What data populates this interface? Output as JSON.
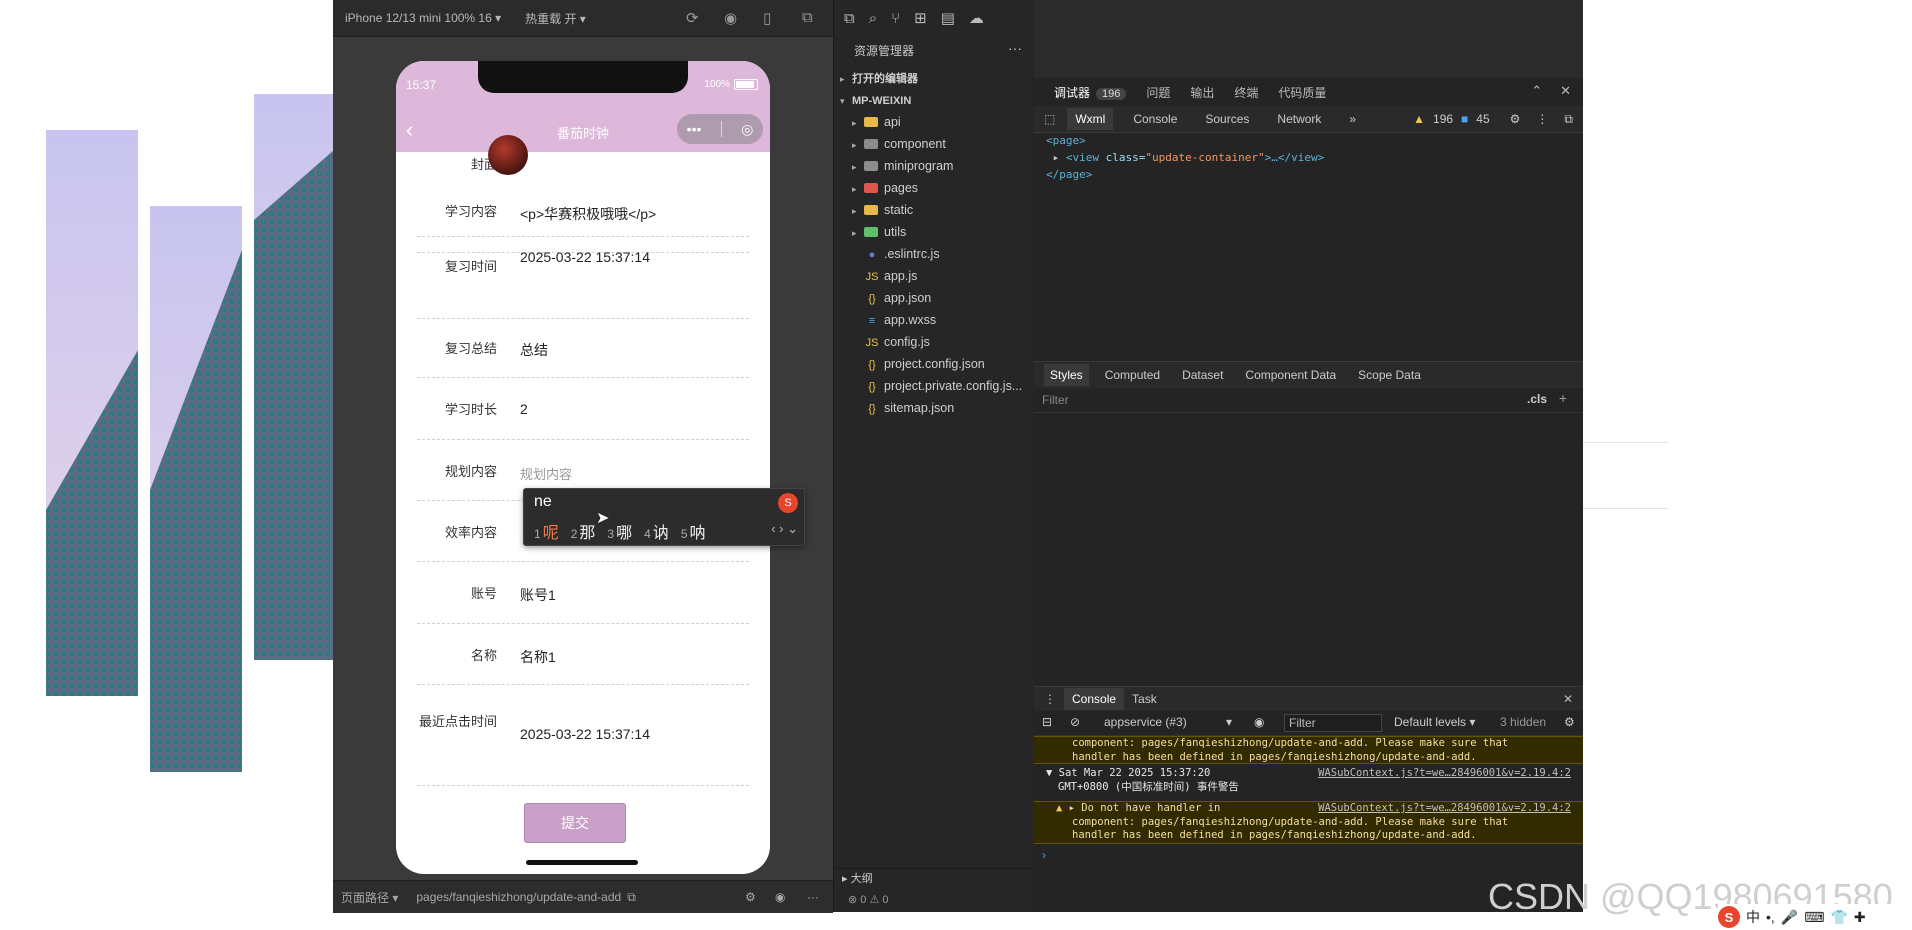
{
  "simulator": {
    "device": "iPhone 12/13 mini 100% 16 ▾",
    "hot_reload": "热重载 开 ▾",
    "phone": {
      "status_time": "15:37",
      "battery_text": "100%",
      "nav_title": "番茄时钟",
      "form": {
        "cover_label": "封面",
        "study_label": "学习内容",
        "study_value": "<p>华赛积极哦哦</p>",
        "review_time_label": "复习时间",
        "review_time_value": "2025-03-22 15:37:14",
        "review_summary_label": "复习总结",
        "review_summary_value": "总结",
        "duration_label": "学习时长",
        "duration_value": "2",
        "plan_label": "规划内容",
        "plan_placeholder": "规划内容",
        "efficiency_label": "效率内容",
        "account_label": "账号",
        "account_value": "账号1",
        "name_label": "名称",
        "name_value": "名称1",
        "last_click_label": "最近点击时间",
        "last_click_value": "2025-03-22 15:37:14",
        "submit_label": "提交"
      }
    },
    "bottom": {
      "path_label": "页面路径 ▾",
      "path_value": "pages/fanqieshizhong/update-and-add"
    }
  },
  "ime": {
    "input": "ne",
    "candidates": [
      {
        "num": "1",
        "text": "呢"
      },
      {
        "num": "2",
        "text": "那"
      },
      {
        "num": "3",
        "text": "哪"
      },
      {
        "num": "4",
        "text": "讷"
      },
      {
        "num": "5",
        "text": "呐"
      }
    ],
    "arrows": "‹ › ⌄"
  },
  "explorer": {
    "title": "资源管理器",
    "more": "···",
    "open_editors": "打开的编辑器",
    "root": "MP-WEIXIN",
    "items": [
      {
        "name": "api",
        "type": "folder",
        "color": "#e9b84a"
      },
      {
        "name": "component",
        "type": "folder",
        "color": "#8c8c8c"
      },
      {
        "name": "miniprogram",
        "type": "folder",
        "color": "#8c8c8c"
      },
      {
        "name": "pages",
        "type": "folder",
        "color": "#e0574f"
      },
      {
        "name": "static",
        "type": "folder",
        "color": "#e9b84a"
      },
      {
        "name": "utils",
        "type": "folder",
        "color": "#5fbf6a"
      },
      {
        "name": ".eslintrc.js",
        "type": "file",
        "icon": "●",
        "color": "#6b7bd6"
      },
      {
        "name": "app.js",
        "type": "file",
        "icon": "JS",
        "color": "#e8c547"
      },
      {
        "name": "app.json",
        "type": "file",
        "icon": "{}",
        "color": "#e8c547"
      },
      {
        "name": "app.wxss",
        "type": "file",
        "icon": "≡",
        "color": "#4ea1f3"
      },
      {
        "name": "config.js",
        "type": "file",
        "icon": "JS",
        "color": "#e8c547"
      },
      {
        "name": "project.config.json",
        "type": "file",
        "icon": "{}",
        "color": "#e8c547"
      },
      {
        "name": "project.private.config.js...",
        "type": "file",
        "icon": "{}",
        "color": "#e8c547"
      },
      {
        "name": "sitemap.json",
        "type": "file",
        "icon": "{}",
        "color": "#e8c547"
      }
    ],
    "outline": "大纲",
    "status": "⊗ 0 ⚠ 0"
  },
  "devtools": {
    "tabs": [
      {
        "label": "调试器",
        "badge": "196",
        "active": true
      },
      {
        "label": "问题"
      },
      {
        "label": "输出"
      },
      {
        "label": "终端"
      },
      {
        "label": "代码质量"
      }
    ],
    "panel_tabs": [
      "Wxml",
      "Console",
      "Sources",
      "Network",
      "»"
    ],
    "warn_count": "196",
    "info_count": "45",
    "code": {
      "line1": "<page>",
      "line2_tag": "<view ",
      "line2_attr": "class=",
      "line2_str": "\"update-container\"",
      "line2_end": ">…</view>",
      "line3": "</page>"
    },
    "styles_tabs": [
      "Styles",
      "Computed",
      "Dataset",
      "Component Data",
      "Scope Data"
    ],
    "filter_placeholder": "Filter",
    "cls_label": ".cls",
    "console_tabs": [
      "Console",
      "Task"
    ],
    "context": "appservice (#3)",
    "console_filter": "Filter",
    "levels": "Default levels ▾",
    "hidden": "3 hidden",
    "logs": {
      "l1a": "component: pages/fanqieshizhong/update-and-add. Please make sure that",
      "l1b": "handler has been defined in pages/fanqieshizhong/update-and-add.",
      "l2a": "▼ Sat Mar 22 2025 15:37:20",
      "l2link": "WASubContext.js?t=we…28496001&v=2.19.4:2",
      "l2b": "GMT+0800 (中国标准时间) 事件警告",
      "l3a": "▸ Do not have  handler in",
      "l3link": "WASubContext.js?t=we…28496001&v=2.19.4:2",
      "l3b": "component: pages/fanqieshizhong/update-and-add. Please make sure that",
      "l3c": "handler has been defined in pages/fanqieshizhong/update-and-add."
    }
  },
  "watermark": "CSDN @QQ1980691580",
  "tray": {
    "ime": "中",
    "symbols": "•,"
  }
}
